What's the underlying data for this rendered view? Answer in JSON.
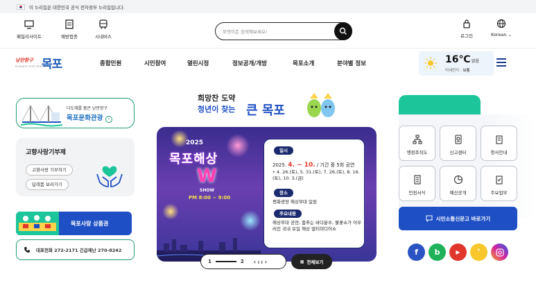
{
  "gov_notice": "이 누리집은 대한민국 공식 전자정부 누리집입니다.",
  "utility": {
    "family_sites": "패밀리사이트",
    "vaccination": "예방접종",
    "city_bus": "시내버스",
    "search_placeholder": "무엇이든 검색해보세요!",
    "login": "로그인",
    "language": "Korean"
  },
  "logo": {
    "slogan": "낭만항구",
    "slogan_en": "ROMANTIC PORT MOKPO",
    "name": "목포"
  },
  "nav": {
    "items": [
      "종합민원",
      "시민참여",
      "열린시정",
      "정보공개/개방",
      "목포소개",
      "분야별 정보"
    ]
  },
  "weather": {
    "temperature": "16℃",
    "condition": "맑음",
    "dust_label": "미세먼지",
    "dust_value": "보통"
  },
  "left": {
    "tour_sub": "다도해를 품은 낭만항구",
    "tour_main": "목포문화관광",
    "gift_title": "고향사랑기부제",
    "gift_btn1": "고향사랑 기부하기",
    "gift_btn2": "답례품 보러가기",
    "shop_label": "목포사랑 상품권",
    "phone_label": "대표전화 272-2171 긴급재난 270-8242"
  },
  "center": {
    "headline_line1": "희망찬 도약",
    "headline_line2": "청년이 찾는",
    "headline_big": "큰 목포",
    "banner": {
      "year": "2025",
      "title": "목포해상",
      "w": "W",
      "show": "SHOW",
      "time": "PM 8:00 ~ 9:00",
      "tag_date": "일시",
      "date_prefix": "2025.",
      "date_big": "4. ~ 10.",
      "date_suffix": " / 기간 중 5회 공연",
      "date_detail": "• 4. 26.(토), 5. 31.(토), 7. 26.(토), 8. 16.(토), 10. 3.(금)",
      "tag_place": "장소",
      "place": "평화광장 해상무대 일원",
      "tag_content": "주요내용",
      "content": "해상무대 공연, 춤추는 바다분수, 불꽃쇼가 어우러진 국내 유일 해상 멀티미디어쇼"
    },
    "slider": {
      "current": "1",
      "total": "2",
      "pause": "II",
      "view_all": "전체보기"
    }
  },
  "right": {
    "tiles": [
      "행정조직도",
      "신고센터",
      "청사안내",
      "민원서식",
      "예산공개",
      "주요업무"
    ],
    "petition": "시민소통신문고 바로가기"
  },
  "colors": {
    "brand_blue": "#1e4fc4",
    "brand_green": "#1d9a76",
    "accent_mint": "#1cc59a"
  }
}
